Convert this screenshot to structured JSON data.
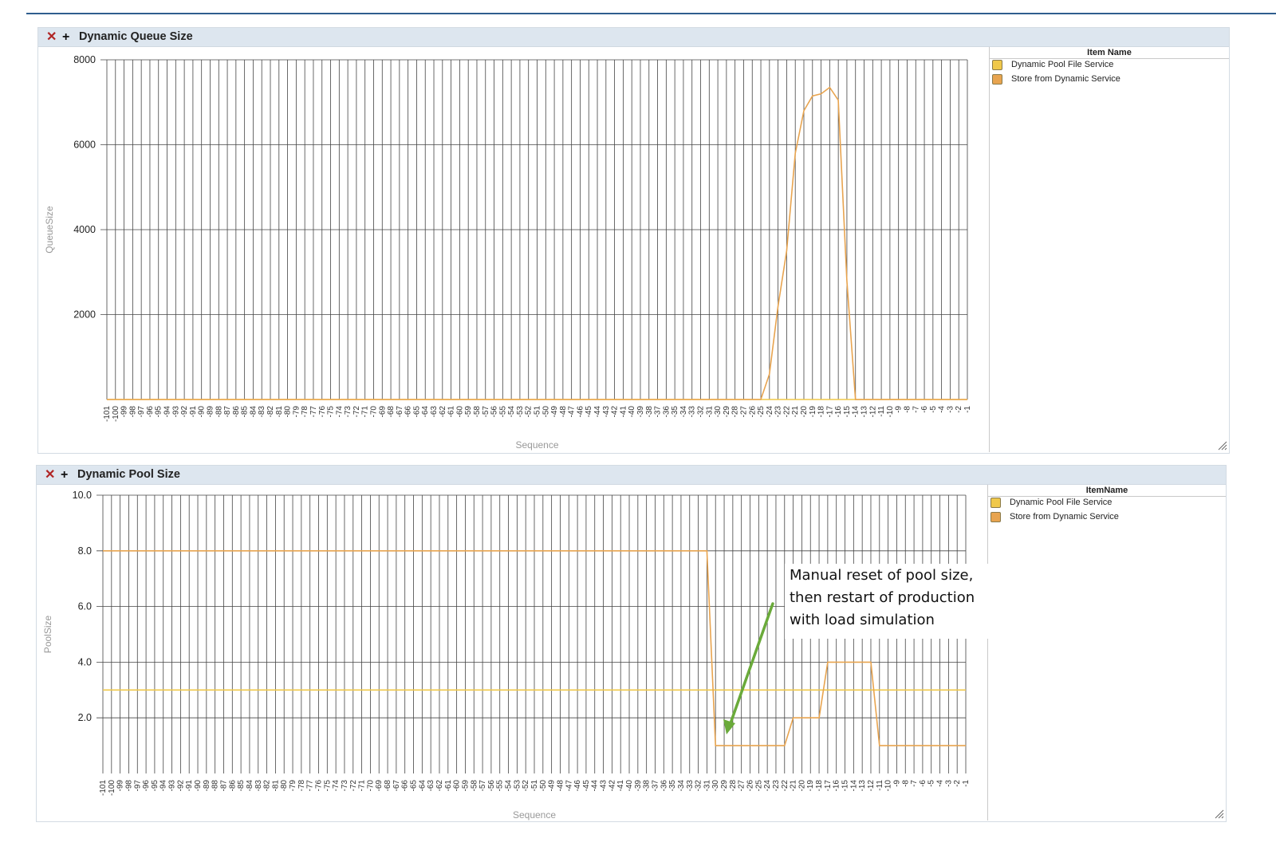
{
  "panels": [
    {
      "title": "Dynamic Queue Size",
      "close_icon": "close-icon",
      "expand_icon": "plus-icon",
      "legend_title": "Item Name",
      "legend": [
        {
          "label": "Dynamic Pool File Service",
          "color": "#f0c84a"
        },
        {
          "label": "Store from Dynamic Service",
          "color": "#e8a44f"
        }
      ]
    },
    {
      "title": "Dynamic Pool Size",
      "close_icon": "close-icon",
      "expand_icon": "plus-icon",
      "legend_title": "ItemName",
      "legend": [
        {
          "label": "Dynamic Pool File Service",
          "color": "#f0c84a"
        },
        {
          "label": "Store from Dynamic Service",
          "color": "#e8a44f"
        }
      ]
    }
  ],
  "annotation": {
    "lines": [
      "Manual reset of pool size,",
      "then restart of production",
      "with load simulation"
    ],
    "arrow_color": "#6aaa3a"
  },
  "chart_data": [
    {
      "type": "line",
      "title": "Dynamic Queue Size",
      "xlabel": "Sequence",
      "ylabel": "QueueSize",
      "x_start": -101,
      "x_end": -1,
      "ylim": [
        0,
        8000
      ],
      "yticks": [
        "8000",
        "6000",
        "4000",
        "2000"
      ],
      "grid": true,
      "legend_position": "right",
      "series": [
        {
          "name": "Dynamic Pool File Service",
          "color": "#f0c84a",
          "constant": 0
        },
        {
          "name": "Store from Dynamic Service",
          "color": "#e8a44f",
          "default": 0,
          "points": {
            "-25": 0,
            "-24": 600,
            "-23": 2200,
            "-22": 3500,
            "-21": 5800,
            "-20": 6800,
            "-19": 7150,
            "-18": 7200,
            "-17": 7350,
            "-16": 7050,
            "-15": 2800,
            "-14": 0
          }
        }
      ]
    },
    {
      "type": "line",
      "title": "Dynamic Pool Size",
      "xlabel": "Sequence",
      "ylabel": "PoolSize",
      "x_start": -101,
      "x_end": -1,
      "ylim": [
        0,
        10
      ],
      "yticks": [
        "10.0",
        "8.0",
        "6.0",
        "4.0",
        "2.0"
      ],
      "grid": true,
      "legend_position": "right",
      "series": [
        {
          "name": "Dynamic Pool File Service",
          "color": "#f0c84a",
          "constant": 3
        },
        {
          "name": "Store from Dynamic Service",
          "color": "#e8a44f",
          "default": 1,
          "segments": [
            {
              "from": -101,
              "to": -31,
              "value": 8
            },
            {
              "from": -30,
              "to": -22,
              "value": 1
            },
            {
              "from": -21,
              "to": -18,
              "value": 2
            },
            {
              "from": -17,
              "to": -12,
              "value": 4
            },
            {
              "from": -11,
              "to": -1,
              "value": 1
            }
          ]
        }
      ]
    }
  ]
}
